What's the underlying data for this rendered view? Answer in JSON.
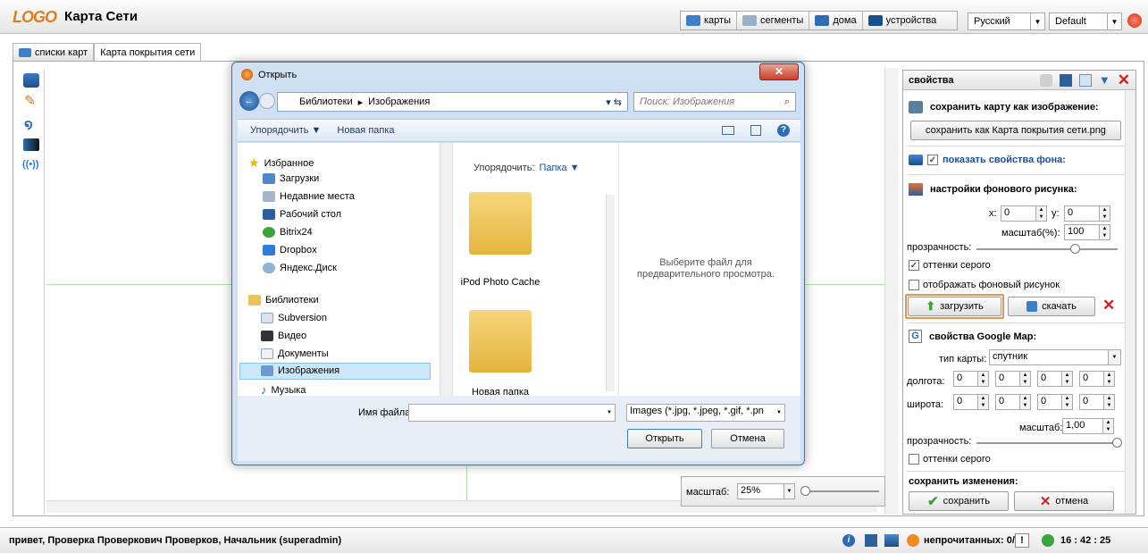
{
  "app": {
    "logo": "LOGO",
    "title": "Карта Сети"
  },
  "nav": [
    {
      "label": "карты",
      "icon": "map-icon",
      "color": "#3c7fc8"
    },
    {
      "label": "сегменты",
      "icon": "segments-icon",
      "color": "#9ab0c8"
    },
    {
      "label": "дома",
      "icon": "house-icon",
      "color": "#2f6db5"
    },
    {
      "label": "устройства",
      "icon": "device-icon",
      "color": "#1b4e8c"
    }
  ],
  "language": "Русский",
  "theme": "Default",
  "tabs": [
    "списки карт",
    "Карта покрытия сети"
  ],
  "properties": {
    "header": "свойства",
    "save_image_title": "сохранить карту как изображение:",
    "save_image_button": "сохранить как Карта покрытия сети.png",
    "show_bg_props": "показать свойства фона:",
    "bg_settings_title": "настройки фонового рисунка:",
    "x_label": "x:",
    "x_value": "0",
    "y_label": "y:",
    "y_value": "0",
    "scale_label": "масштаб(%):",
    "scale_value": "100",
    "opacity_label": "прозрачность:",
    "opacity_level": 0.7,
    "grayscale_label": "оттенки серого",
    "show_bg_label": "отображать фоновый рисунок",
    "upload_button": "загрузить",
    "download_button": "скачать",
    "gmap_title": "свойства Google Map:",
    "map_type_label": "тип карты:",
    "map_type_value": "спутник",
    "longitude_label": "долгота:",
    "latitude_label": "широта:",
    "coord_zero": "0",
    "gmap_scale_label": "масштаб:",
    "gmap_scale_value": "1,00",
    "gmap_opacity_label": "прозрачность:",
    "gmap_opacity_level": 1.0,
    "gmap_grayscale_label": "оттенки серого",
    "save_changes_title": "сохранить изменения:",
    "save_button": "сохранить",
    "cancel_button": "отмена"
  },
  "zoom": {
    "label": "масштаб:",
    "value": "25%"
  },
  "status": {
    "greeting": "привет, Проверка Проверкович Проверков, Начальник (superadmin)",
    "unread": "непрочитанных: 0/2",
    "time": "16 : 42 : 25"
  },
  "dialog": {
    "title": "Открыть",
    "breadcrumb": [
      "Библиотеки",
      "Изображения"
    ],
    "search_placeholder": "Поиск: Изображения",
    "organize": "Упорядочить ▼",
    "new_folder": "Новая папка",
    "favorites": "Избранное",
    "fav_items": [
      "Загрузки",
      "Недавние места",
      "Рабочий стол",
      "Bitrix24",
      "Dropbox",
      "Яндекс.Диск"
    ],
    "libraries": "Библиотеки",
    "lib_items": [
      "Subversion",
      "Видео",
      "Документы",
      "Изображения",
      "Музыка"
    ],
    "arrange_label": "Упорядочить:",
    "arrange_value": "Папка ▼",
    "folders": [
      "iPod Photo Cache",
      "Новая папка"
    ],
    "preview_text": "Выберите файл для предварительного просмотра.",
    "filename_label": "Имя файла:",
    "filename_value": "",
    "filter": "Images (*.jpg, *.jpeg, *.gif, *.pn",
    "open_button": "Открыть",
    "cancel_button": "Отмена"
  }
}
